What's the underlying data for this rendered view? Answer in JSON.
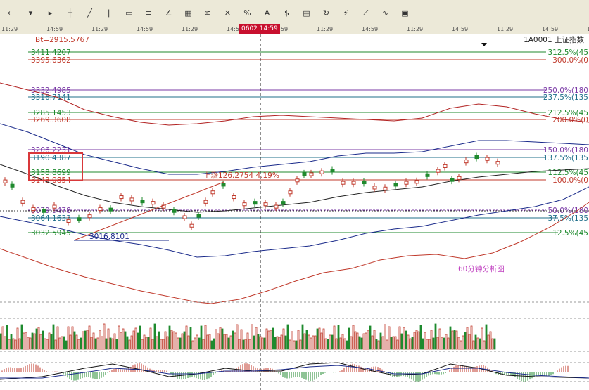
{
  "toolbar": {
    "icons": [
      "arrow-left-icon",
      "arrow-down-icon",
      "cursor-icon",
      "crosshair-icon",
      "line-tool-icon",
      "channel-tool-icon",
      "rectangle-tool-icon",
      "fib-tool-icon",
      "gann-tool-icon",
      "grid-tool-icon",
      "regression-tool-icon",
      "delete-tool-icon",
      "percent-icon",
      "text-icon",
      "price-icon",
      "calendar-icon",
      "cycle-icon",
      "speed-icon",
      "fan-icon",
      "wave-icon",
      "box-icon"
    ]
  },
  "timebar": {
    "ticks": [
      "11:29",
      "14:59",
      "11:29",
      "14:59",
      "11:29",
      "14:59",
      "14:59",
      "11:29",
      "14:59",
      "11:29",
      "14:59",
      "11:29",
      "14:59",
      "11:29"
    ],
    "cursor_time": "0602 14:59"
  },
  "info": {
    "bt_value": "Bt=2915.5767",
    "symbol": "1A0001  上证指数"
  },
  "fib_levels": [
    {
      "price": "3411.4207",
      "pct": "312.5%(45",
      "color": "#1f8a2e"
    },
    {
      "price": "3395.6362",
      "pct": "300.0%(0",
      "color": "#c0392b"
    },
    {
      "price": "3332.4985",
      "pct": "250.0%(180",
      "color": "#7a3aa6"
    },
    {
      "price": "3316.7141",
      "pct": "237.5%(135",
      "color": "#1f6f8a"
    },
    {
      "price": "3285.1453",
      "pct": "212.5%(45",
      "color": "#1f8a2e"
    },
    {
      "price": "3269.3608",
      "pct": "200.0%(0",
      "color": "#c0392b"
    },
    {
      "price": "3206.2231",
      "pct": "150.0%(180",
      "color": "#7a3aa6"
    },
    {
      "price": "3190.4387",
      "pct": "137.5%(135",
      "color": "#1f6f8a"
    },
    {
      "price": "3158.8699",
      "pct": "112.5%(45",
      "color": "#1f8a2e"
    },
    {
      "price": "3143.0854",
      "pct": "100.0%(0",
      "color": "#c0392b"
    },
    {
      "price": "3079.9478",
      "pct": "50.0%(180",
      "color": "#7a3aa6"
    },
    {
      "price": "3064.1633",
      "pct": "37.5%(135",
      "color": "#1f6f8a"
    },
    {
      "price": "3032.5945",
      "pct": "12.5%(45",
      "color": "#1f8a2e"
    }
  ],
  "annotations": {
    "low_price": "3016.8101",
    "rise_label": "上涨126.2754 4.19%",
    "analysis_title": "60分钟分析图"
  },
  "colors": {
    "up": "#c0392b",
    "down": "#1f8a2e",
    "box": "#d9383a",
    "accent": "#c8102e",
    "title": "#c040c0"
  }
}
